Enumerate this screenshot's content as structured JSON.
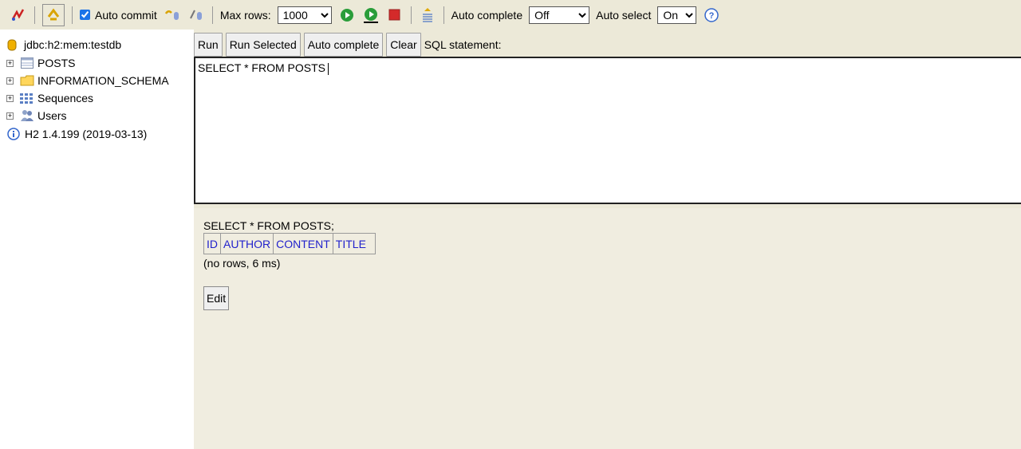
{
  "toolbar": {
    "auto_commit_label": "Auto commit",
    "auto_commit_checked": true,
    "max_rows_label": "Max rows:",
    "max_rows_value": "1000",
    "auto_complete_label": "Auto complete",
    "auto_complete_value": "Off",
    "auto_select_label": "Auto select",
    "auto_select_value": "On",
    "help_symbol": "?"
  },
  "tree": {
    "connection": "jdbc:h2:mem:testdb",
    "items": [
      {
        "label": "POSTS",
        "icon": "table-icon"
      },
      {
        "label": "INFORMATION_SCHEMA",
        "icon": "folder-icon"
      },
      {
        "label": "Sequences",
        "icon": "sequences-icon"
      },
      {
        "label": "Users",
        "icon": "users-icon"
      }
    ],
    "version": "H2 1.4.199 (2019-03-13)"
  },
  "query": {
    "run_label": "Run",
    "run_selected_label": "Run Selected",
    "auto_complete_label": "Auto complete",
    "clear_label": "Clear",
    "sql_label": "SQL statement:",
    "sql_text": "SELECT * FROM POSTS"
  },
  "result": {
    "statement": "SELECT * FROM POSTS;",
    "columns": [
      "ID",
      "AUTHOR",
      "CONTENT",
      "TITLE"
    ],
    "info": "(no rows, 6 ms)",
    "edit_label": "Edit"
  }
}
